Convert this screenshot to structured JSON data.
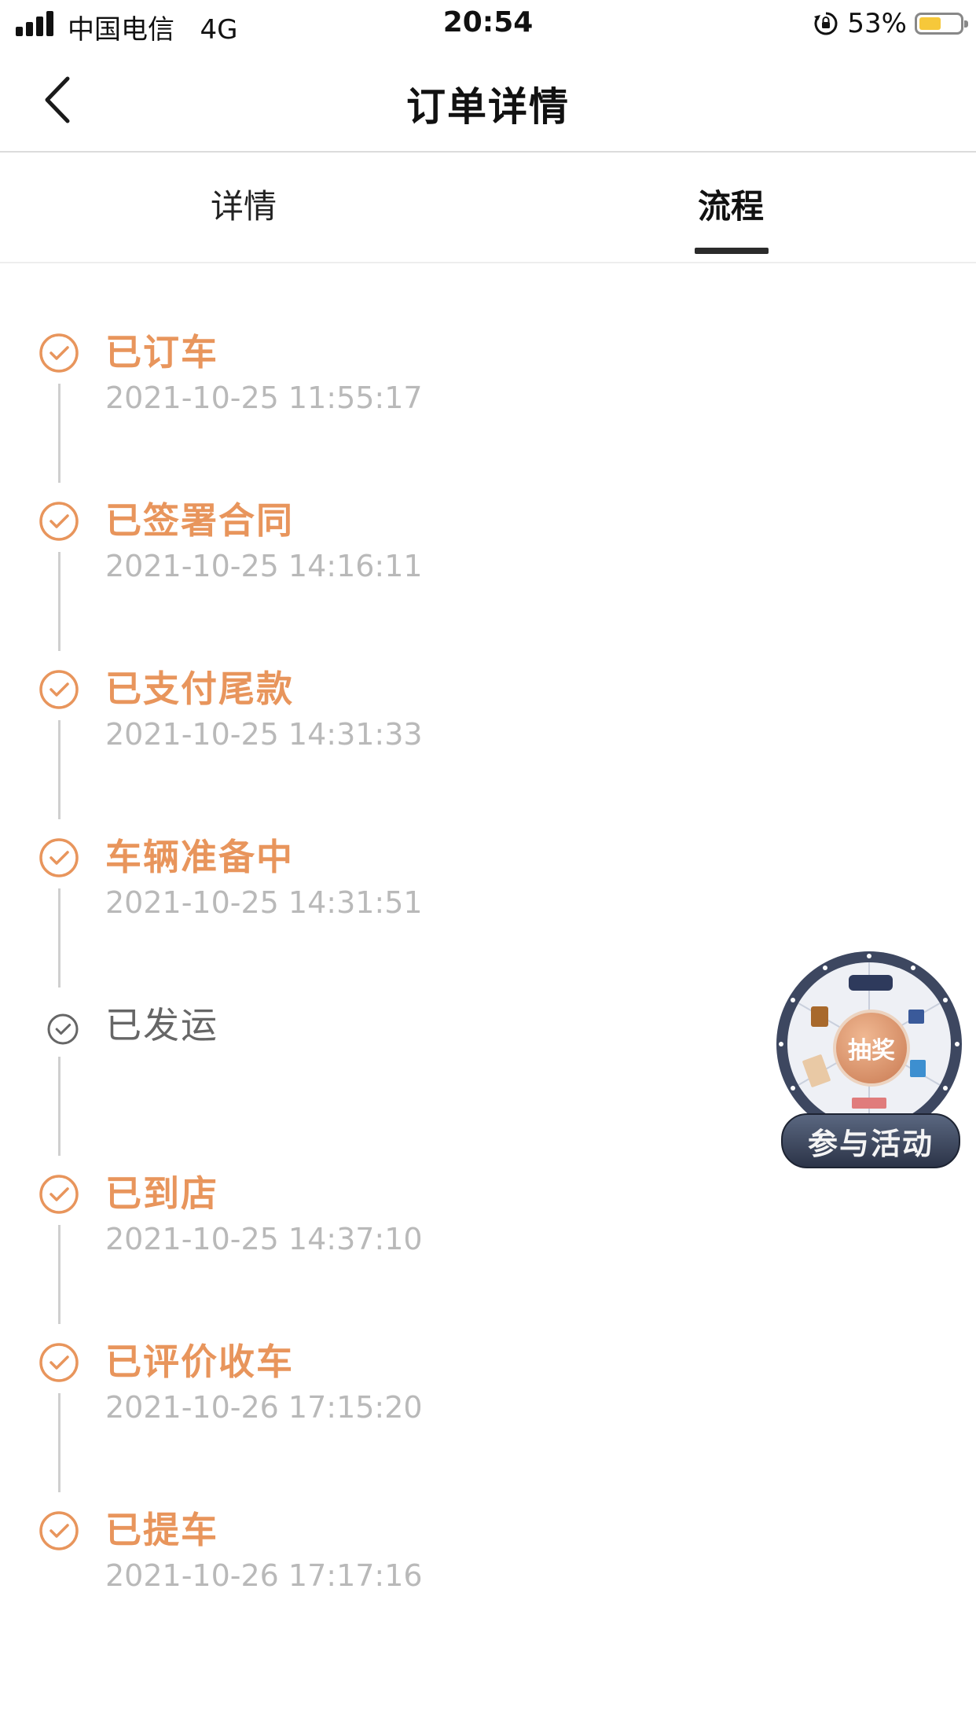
{
  "status_bar": {
    "carrier": "中国电信",
    "network": "4G",
    "time": "20:54",
    "battery_text": "53%",
    "battery_level": 0.53
  },
  "nav": {
    "title": "订单详情"
  },
  "tabs": [
    {
      "label": "详情",
      "active": false
    },
    {
      "label": "流程",
      "active": true
    }
  ],
  "timeline": [
    {
      "title": "已订车",
      "time": "2021-10-25 11:55:17",
      "done": true
    },
    {
      "title": "已签署合同",
      "time": "2021-10-25 14:16:11",
      "done": true
    },
    {
      "title": "已支付尾款",
      "time": "2021-10-25 14:31:33",
      "done": true
    },
    {
      "title": "车辆准备中",
      "time": "2021-10-25 14:31:51",
      "done": true
    },
    {
      "title": "已发运",
      "time": "",
      "done": false
    },
    {
      "title": "已到店",
      "time": "2021-10-25 14:37:10",
      "done": true
    },
    {
      "title": "已评价收车",
      "time": "2021-10-26 17:15:20",
      "done": true
    },
    {
      "title": "已提车",
      "time": "2021-10-26 17:17:16",
      "done": true
    }
  ],
  "lottery": {
    "center_label": "抽奖",
    "button_label": "参与活动"
  },
  "colors": {
    "accent": "#e8955c",
    "pending": "#666666",
    "muted_time": "#b9b9b9",
    "battery": "#f6c83a"
  }
}
